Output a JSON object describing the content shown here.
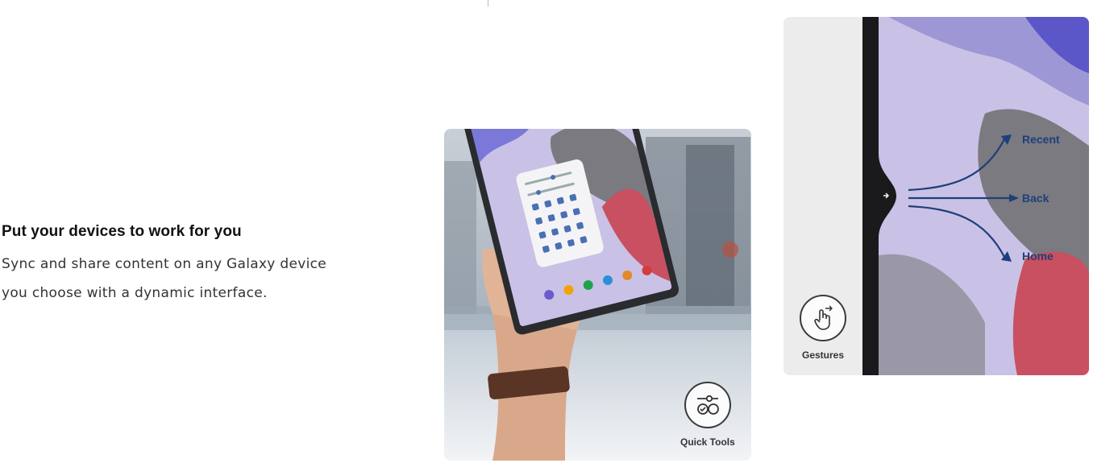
{
  "feature": {
    "title": "Put your devices to work for you",
    "description_line1": "Sync and share content on any Galaxy device",
    "description_line2": "you choose with a dynamic interface."
  },
  "quick_tools": {
    "label": "Quick Tools",
    "icon": "quick-tools-icon"
  },
  "gestures": {
    "label": "Gestures",
    "icon": "gesture-hand-icon",
    "arrows": {
      "recent": "Recent",
      "back": "Back",
      "home": "Home"
    }
  },
  "colors": {
    "accent_blue": "#1f3f7a",
    "wallpaper_purple": "#c9c2e6",
    "wallpaper_red": "#c95060"
  }
}
